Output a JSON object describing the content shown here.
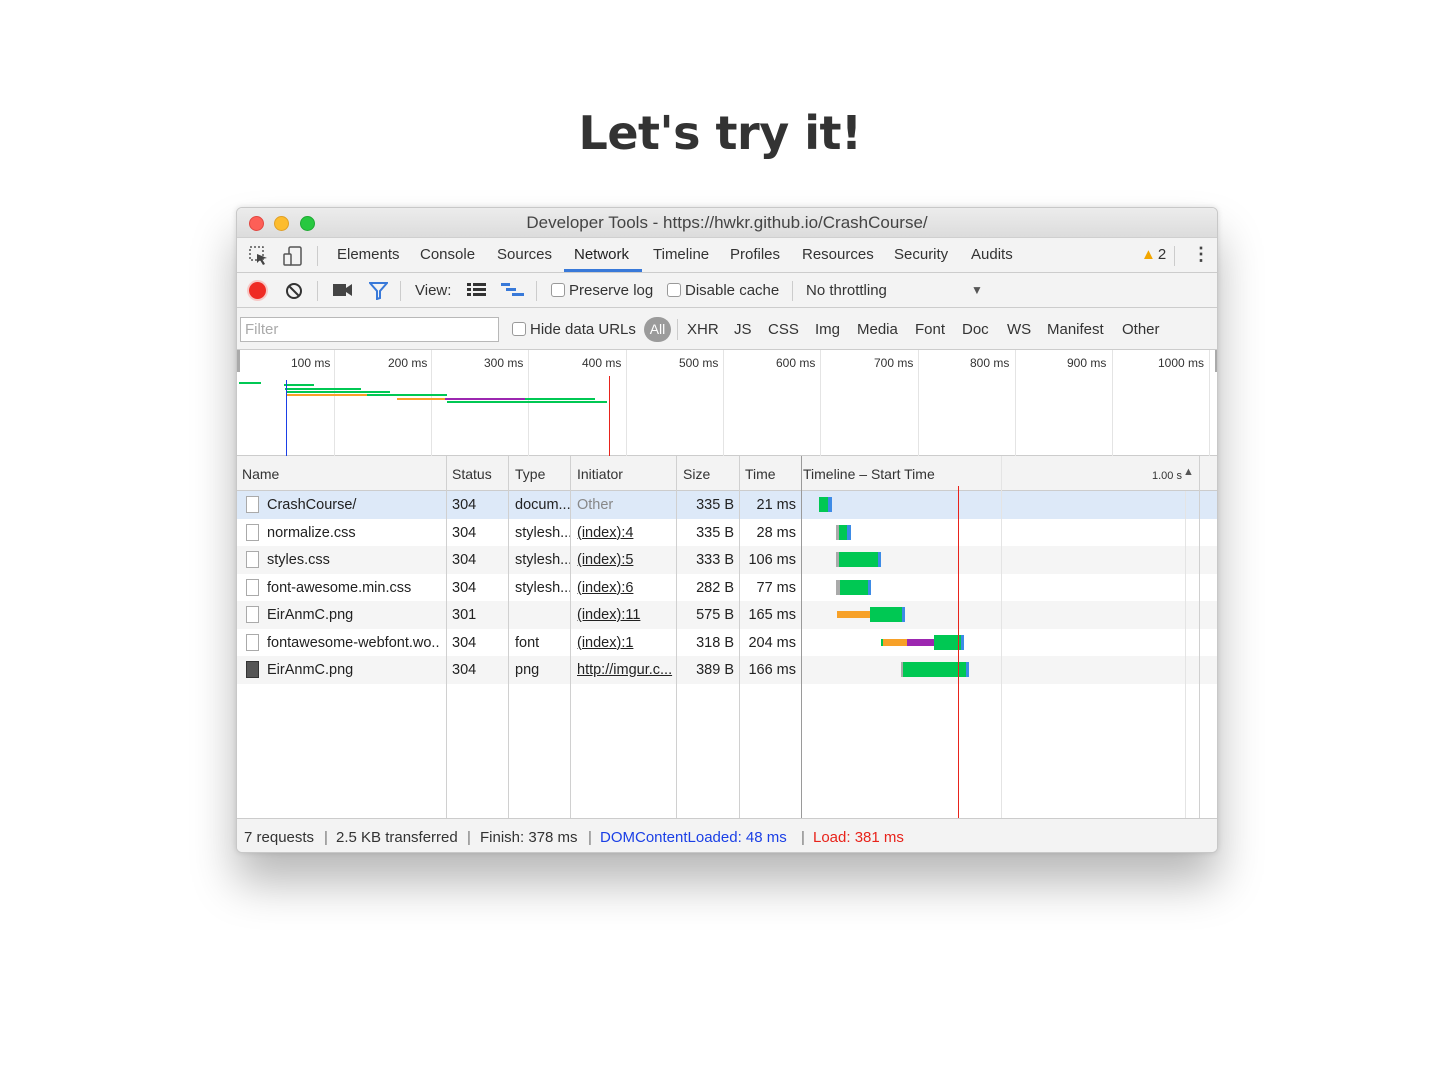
{
  "slide": {
    "title": "Let's try it!"
  },
  "window": {
    "title": "Developer Tools - https://hwkr.github.io/CrashCourse/"
  },
  "tabs": [
    "Elements",
    "Console",
    "Sources",
    "Network",
    "Timeline",
    "Profiles",
    "Resources",
    "Security",
    "Audits"
  ],
  "active_tab": "Network",
  "warnings": {
    "count": "2"
  },
  "toolbar": {
    "view_label": "View:",
    "preserve_log": "Preserve log",
    "disable_cache": "Disable cache",
    "throttling": "No throttling"
  },
  "filter": {
    "placeholder": "Filter",
    "hide_data_urls": "Hide data URLs",
    "types": [
      "All",
      "XHR",
      "JS",
      "CSS",
      "Img",
      "Media",
      "Font",
      "Doc",
      "WS",
      "Manifest",
      "Other"
    ],
    "active_type": "All"
  },
  "overview": {
    "ticks": [
      "100 ms",
      "200 ms",
      "300 ms",
      "400 ms",
      "500 ms",
      "600 ms",
      "700 ms",
      "800 ms",
      "900 ms",
      "1000 ms"
    ]
  },
  "columns": {
    "name": "Name",
    "status": "Status",
    "type": "Type",
    "initiator": "Initiator",
    "size": "Size",
    "time": "Time",
    "timeline": "Timeline – Start Time",
    "scale": "1.00 s"
  },
  "requests": [
    {
      "name": "CrashCourse/",
      "status": "304",
      "type": "docum...",
      "initiator": "Other",
      "size": "335 B",
      "time": "21 ms"
    },
    {
      "name": "normalize.css",
      "status": "304",
      "type": "stylesh...",
      "initiator": "(index):4",
      "size": "335 B",
      "time": "28 ms"
    },
    {
      "name": "styles.css",
      "status": "304",
      "type": "stylesh...",
      "initiator": "(index):5",
      "size": "333 B",
      "time": "106 ms"
    },
    {
      "name": "font-awesome.min.css",
      "status": "304",
      "type": "stylesh...",
      "initiator": "(index):6",
      "size": "282 B",
      "time": "77 ms"
    },
    {
      "name": "EirAnmC.png",
      "status": "301",
      "type": "",
      "initiator": "(index):11",
      "size": "575 B",
      "time": "165 ms"
    },
    {
      "name": "fontawesome-webfont.wo...",
      "status": "304",
      "type": "font",
      "initiator": "(index):1",
      "size": "318 B",
      "time": "204 ms"
    },
    {
      "name": "EirAnmC.png",
      "status": "304",
      "type": "png",
      "initiator": "http://imgur.c...",
      "size": "389 B",
      "time": "166 ms"
    }
  ],
  "status": {
    "requests": "7 requests",
    "transferred": "2.5 KB transferred",
    "finish": "Finish: 378 ms",
    "dom_content_loaded": "DOMContentLoaded: 48 ms",
    "load": "Load: 381 ms"
  },
  "colors": {
    "waiting": "#00c853",
    "queue": "#f7a128",
    "ssl": "#9c27b0",
    "download": "#3d8be6",
    "load_line": "#e8231b",
    "dcl_line": "#1a3fe6"
  }
}
